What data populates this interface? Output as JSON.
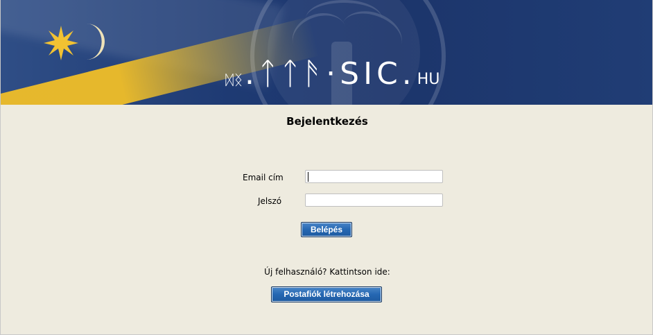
{
  "banner": {
    "logo_runes": "ᛞᛝ",
    "logo_main": ".ᛏᛏᚫ·SIC.",
    "logo_tld": "HU"
  },
  "login": {
    "title": "Bejelentkezés",
    "email_label": "Email cím",
    "email_value": "",
    "password_label": "Jelszó",
    "password_value": "",
    "submit_label": "Belépés"
  },
  "register": {
    "prompt": "Új felhasználó? Kattintson ide:",
    "button_label": "Postafiók létrehozása"
  },
  "colors": {
    "banner_blue": "#1e3a73",
    "flag_gold": "#f0be28",
    "page_bg": "#eeebdf",
    "button_blue": "#2567b2"
  }
}
